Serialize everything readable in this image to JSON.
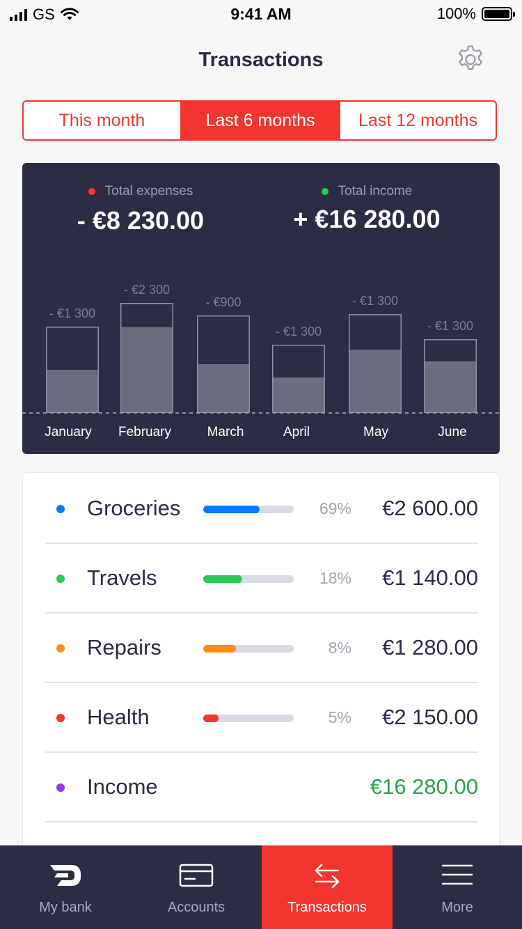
{
  "status_bar": {
    "carrier": "GS",
    "time": "9:41 AM",
    "battery": "100%"
  },
  "header": {
    "title": "Transactions",
    "settings_icon": "gear-icon"
  },
  "periods": [
    {
      "label": "This month",
      "active": false
    },
    {
      "label": "Last 6 months",
      "active": true
    },
    {
      "label": "Last 12 months",
      "active": false
    }
  ],
  "summary": {
    "expenses": {
      "label": "Total expenses",
      "value": "- €8 230.00",
      "color": "#f2362f"
    },
    "income": {
      "label": "Total income",
      "value": "+ €16 280.00",
      "color": "#2bc75a"
    }
  },
  "chart_data": {
    "type": "bar",
    "categories": [
      "January",
      "February",
      "March",
      "April",
      "May",
      "June"
    ],
    "value_labels": [
      "- €1 300",
      "- €2 300",
      "- €900",
      "- €1 300",
      "- €1 300",
      "- €1 300"
    ],
    "series": [
      {
        "values": [
          0.5,
          0.78,
          0.5,
          0.52,
          0.64,
          0.7
        ]
      }
    ],
    "outline_values": [
      1.0,
      1.0,
      1.0,
      1.0,
      1.0,
      1.0
    ]
  },
  "categories": [
    {
      "name": "Groceries",
      "color": "#0a7aff",
      "percent": "69%",
      "fill": 0.62,
      "amount": "€2 600.00",
      "income": false
    },
    {
      "name": "Travels",
      "color": "#2bc75a",
      "percent": "18%",
      "fill": 0.43,
      "amount": "€1 140.00",
      "income": false
    },
    {
      "name": "Repairs",
      "color": "#ff8c1a",
      "percent": "8%",
      "fill": 0.36,
      "amount": "€1 280.00",
      "income": false
    },
    {
      "name": "Health",
      "color": "#f2362f",
      "percent": "5%",
      "fill": 0.17,
      "amount": "€2 150.00",
      "income": false
    },
    {
      "name": "Income",
      "color": "#a033e8",
      "percent": "",
      "fill": null,
      "amount": "€16 280.00",
      "income": true
    }
  ],
  "tabs": [
    {
      "label": "My bank",
      "icon": "bank-logo-icon",
      "active": false
    },
    {
      "label": "Accounts",
      "icon": "card-icon",
      "active": false
    },
    {
      "label": "Transactions",
      "icon": "transfer-arrows-icon",
      "active": true
    },
    {
      "label": "More",
      "icon": "menu-icon",
      "active": false
    }
  ]
}
